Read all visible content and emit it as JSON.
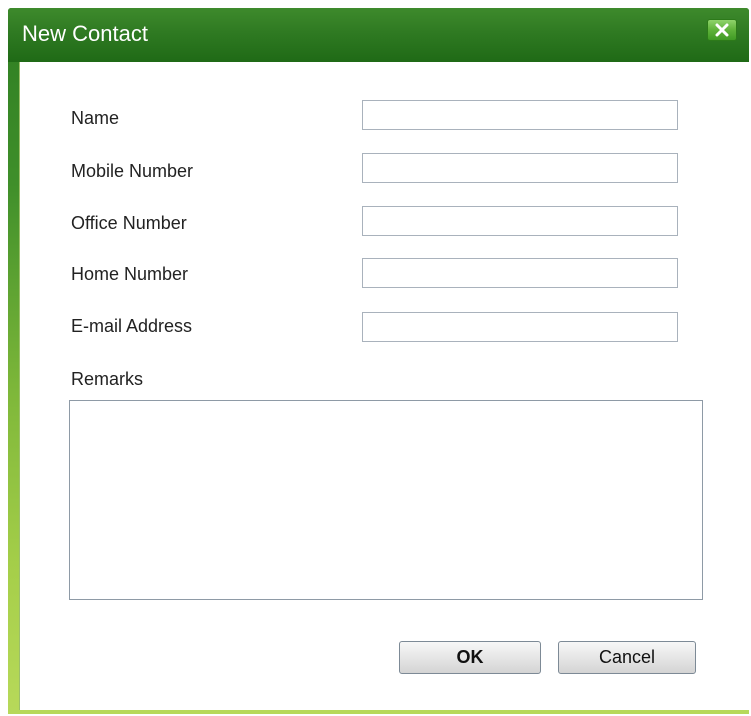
{
  "window": {
    "title": "New Contact",
    "close_icon": "close-icon"
  },
  "form": {
    "fields": [
      {
        "label": "Name",
        "value": ""
      },
      {
        "label": "Mobile Number",
        "value": ""
      },
      {
        "label": "Office Number",
        "value": ""
      },
      {
        "label": "Home Number",
        "value": ""
      },
      {
        "label": "E-mail Address",
        "value": ""
      }
    ],
    "remarks_label": "Remarks",
    "remarks_value": ""
  },
  "buttons": {
    "ok_label": "OK",
    "cancel_label": "Cancel"
  },
  "colors": {
    "titlebar": "#2f7a22",
    "frame_accent": "#a6cf4a",
    "close_button": "#5fb23a"
  }
}
